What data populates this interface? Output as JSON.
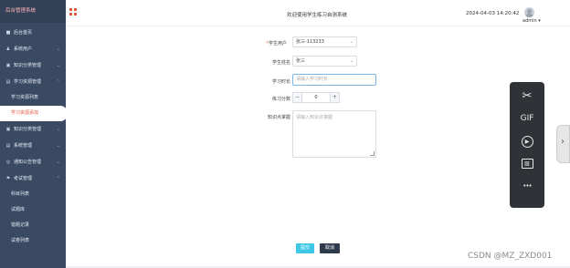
{
  "sidebar": {
    "brand": "后台管理系统",
    "items": [
      {
        "label": "后台首页",
        "icon": "home-icon",
        "glyph": "■"
      },
      {
        "label": "系统用户",
        "icon": "user-icon",
        "glyph": "♟"
      },
      {
        "label": "知识分类管理",
        "icon": "folder-icon",
        "glyph": "▣"
      },
      {
        "label": "学习资源管理",
        "icon": "book-icon",
        "glyph": "▤"
      },
      {
        "label": "学习资源列表"
      },
      {
        "label": "学习资源添加"
      },
      {
        "label": "知识分类管理",
        "icon": "folder-icon",
        "glyph": "▣"
      },
      {
        "label": "系统管理",
        "icon": "settings-icon",
        "glyph": "▤"
      },
      {
        "label": "通知公告管理",
        "icon": "bell-icon",
        "glyph": "◎"
      },
      {
        "label": "考试管理",
        "icon": "flag-icon",
        "glyph": "⚑"
      },
      {
        "label": "科目列表"
      },
      {
        "label": "试题库"
      },
      {
        "label": "错题记录"
      },
      {
        "label": "试卷列表"
      }
    ]
  },
  "header": {
    "welcome": "欢迎使用学生练习自测系统",
    "datetime": "2024-04-03 14:20:42",
    "user": "admin ▾"
  },
  "form": {
    "student_user_label": "学生用户",
    "student_user_value": "张三-113233",
    "student_name_label": "学生姓名",
    "student_name_value": "张三",
    "study_time_label": "学习时长",
    "study_time_placeholder": "请输入学习时长",
    "score_label": "练习分数",
    "score_value": "0",
    "minus": "−",
    "plus": "+",
    "knowledge_label": "知识点掌握",
    "knowledge_placeholder": "请输入知识点掌握",
    "submit": "提交",
    "cancel": "取消"
  },
  "tools": [
    {
      "icon": "scissors-icon",
      "glyph": "✂"
    },
    {
      "icon": "gif-icon",
      "glyph": "GIF"
    },
    {
      "icon": "video-play-icon",
      "glyph": "▶"
    },
    {
      "icon": "image-icon",
      "glyph": "▨"
    },
    {
      "icon": "more-icon",
      "glyph": "•••"
    }
  ],
  "watermark": "CSDN @MZ_ZXD001",
  "colors": {
    "sidebar_bg": "#3a4a63",
    "accent_red": "#e4573b",
    "submit_bg": "#3ec8e6",
    "cancel_bg": "#2f3a4c"
  }
}
